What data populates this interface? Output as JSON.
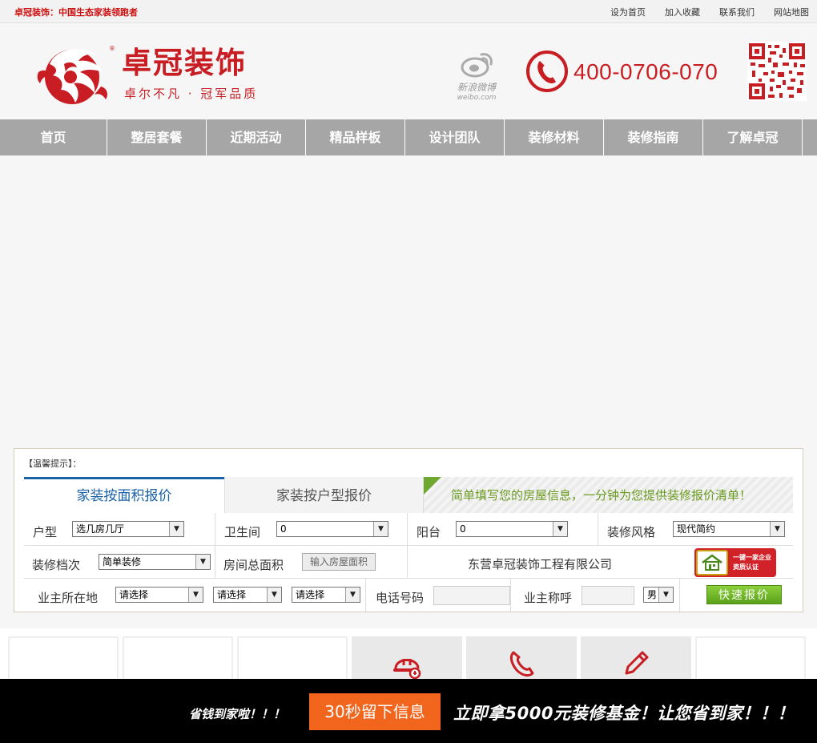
{
  "topbar": {
    "slogan": "卓冠装饰：中国生态家装领跑者",
    "links": [
      "设为首页",
      "加入收藏",
      "联系我们",
      "网站地图"
    ]
  },
  "header": {
    "logo_title": "卓冠装饰",
    "logo_subtitle": "卓尔不凡 · 冠军品质",
    "reg_mark": "®",
    "weibo_cn": "新浪微博",
    "weibo_en": "weibo.com",
    "phone": "400-0706-070"
  },
  "nav": [
    "首页",
    "整居套餐",
    "近期活动",
    "精品样板",
    "设计团队",
    "装修材料",
    "装修指南",
    "了解卓冠"
  ],
  "quote": {
    "tip": "【温馨提示】：",
    "tab_area": "家装按面积报价",
    "tab_layout": "家装按户型报价",
    "message": "简单填写您的房屋信息，一分钟为您提供装修报价清单！",
    "row1": {
      "layout_label": "户型",
      "layout_value": "选几房几厅",
      "bath_label": "卫生间",
      "bath_value": "0",
      "balcony_label": "阳台",
      "balcony_value": "0",
      "style_label": "装修风格",
      "style_value": "现代简约"
    },
    "row2": {
      "grade_label": "装修档次",
      "grade_value": "简单装修",
      "area_label": "房间总面积",
      "area_button": "输入房屋面积",
      "company": "东营卓冠装饰工程有限公司",
      "cert_line1": "一键一家企业",
      "cert_line2": "资质认证"
    },
    "row3": {
      "location_label": "业主所在地",
      "province": "请选择",
      "city": "请选择",
      "district": "请选择",
      "phone_label": "电话号码",
      "name_label": "业主称呼",
      "gender": "男",
      "quick_button": "快速报价"
    }
  },
  "bottombar": {
    "save_text": "省钱到家啦！！！",
    "cta": "30秒留下信息",
    "promo": "立即拿5000元装修基金！让您省到家！！！"
  },
  "colors": {
    "brand_red": "#c71d23",
    "nav_grey": "#a6a6a6",
    "tab_blue": "#1a62a8",
    "green": "#6fa82e",
    "cta_orange": "#f2651d"
  }
}
